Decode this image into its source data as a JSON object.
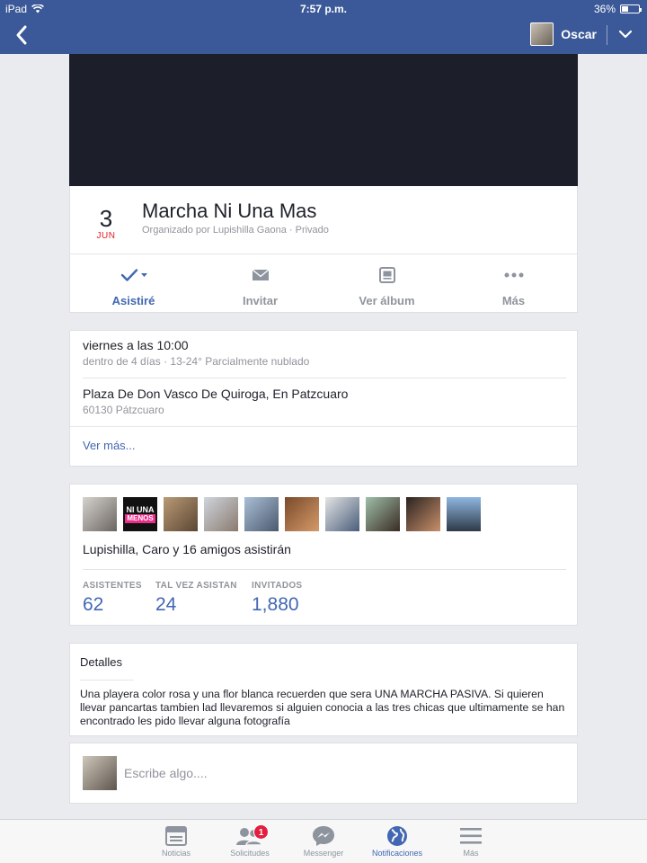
{
  "status_bar": {
    "device": "iPad",
    "time": "7:57 p.m.",
    "battery": "36%"
  },
  "nav": {
    "user_name": "Oscar"
  },
  "event": {
    "date_day": "3",
    "date_month": "JUN",
    "title": "Marcha Ni Una Mas",
    "subtitle": "Organizado por Lupishilla Gaona · Privado",
    "actions": [
      {
        "label": "Asistiré",
        "icon": "check-dropdown-icon"
      },
      {
        "label": "Invitar",
        "icon": "envelope-icon"
      },
      {
        "label": "Ver álbum",
        "icon": "album-icon"
      },
      {
        "label": "Más",
        "icon": "more-dots-icon"
      }
    ]
  },
  "info": {
    "time": "viernes a las 10:00",
    "time_sub": "dentro de 4 días · 13-24° Parcialmente nublado",
    "place": "Plaza De Don Vasco De Quiroga, En Patzcuaro",
    "place_sub": "60130 Pátzcuaro",
    "more": "Ver más..."
  },
  "guests": {
    "avatar_badge_text": [
      "NI UNA",
      "MENOS"
    ],
    "going_text": "Lupishilla, Caro y 16 amigos asistirán",
    "stats": [
      {
        "label": "ASISTENTES",
        "value": "62"
      },
      {
        "label": "TAL VEZ ASISTAN",
        "value": "24"
      },
      {
        "label": "INVITADOS",
        "value": "1,880"
      }
    ]
  },
  "details": {
    "heading": "Detalles",
    "text": "Una playera color rosa y una flor blanca recuerden que sera UNA MARCHA PASIVA. Si quieren llevar pancartas tambien lad llevaremos si alguien conocia a las tres chicas que ultimamente se han encontrado les pido llevar alguna fotografía"
  },
  "compose": {
    "placeholder": "Escribe algo...."
  },
  "tabs": [
    {
      "label": "Noticias",
      "icon": "news-feed-icon"
    },
    {
      "label": "Solicitudes",
      "icon": "friend-requests-icon",
      "badge": "1"
    },
    {
      "label": "Messenger",
      "icon": "messenger-icon"
    },
    {
      "label": "Notificaciones",
      "icon": "globe-icon",
      "active": true
    },
    {
      "label": "Más",
      "icon": "menu-icon"
    }
  ],
  "colors": {
    "brand": "#3b5998",
    "link": "#4267b2",
    "date_month": "#e02020",
    "badge": "#e41e3f"
  }
}
